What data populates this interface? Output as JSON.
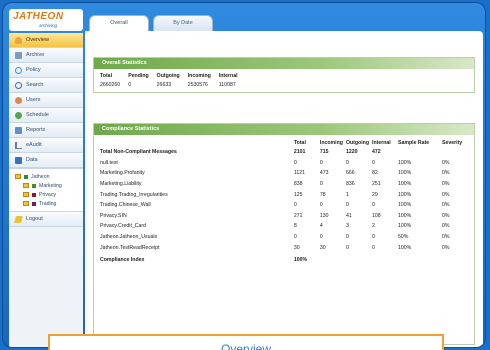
{
  "brand": {
    "name": "JATHEON",
    "tagline": "archiving"
  },
  "tabs": [
    {
      "label": "Overall",
      "active": true
    },
    {
      "label": "By Date",
      "active": false
    }
  ],
  "sidebar": {
    "items": [
      {
        "label": "Overview",
        "icon": "home-icon",
        "active": true
      },
      {
        "label": "Archive",
        "icon": "archive-icon"
      },
      {
        "label": "Policy",
        "icon": "policy-icon"
      },
      {
        "label": "Search",
        "icon": "search-icon"
      },
      {
        "label": "Users",
        "icon": "users-icon"
      },
      {
        "label": "Schedule",
        "icon": "schedule-icon"
      },
      {
        "label": "Reports",
        "icon": "reports-icon"
      },
      {
        "label": "eAudit",
        "icon": "audit-icon"
      },
      {
        "label": "Data",
        "icon": "data-icon"
      }
    ],
    "folders": [
      {
        "label": "Jatheon",
        "color": "#2e8b3a",
        "sub": false
      },
      {
        "label": "Marketing",
        "color": "#4a8a2a",
        "sub": true
      },
      {
        "label": "Privacy",
        "color": "#8a1a2a",
        "sub": true
      },
      {
        "label": "Trading",
        "color": "#6a1a7a",
        "sub": true
      }
    ],
    "logout": "Logout"
  },
  "overall": {
    "title": "Overall Statistics",
    "headers": [
      "Total",
      "Pending",
      "Outgoing",
      "Incoming",
      "Internal"
    ],
    "values": [
      "2660260",
      "0",
      "26633",
      "2530576",
      "110087"
    ]
  },
  "compliance": {
    "title": "Compliance Statistics",
    "headers": [
      "",
      "Total",
      "Incoming",
      "Outgoing",
      "Internal",
      "Sample Rate",
      "Severity"
    ],
    "summary": [
      "Total Non-Compliant Messages",
      "2101",
      "715",
      "1220",
      "472",
      "",
      ""
    ],
    "rows": [
      [
        "null.test",
        "0",
        "0",
        "0",
        "0",
        "100%",
        "0%"
      ],
      [
        "Marketing.Profanity",
        "1121",
        "473",
        "666",
        "82",
        "100%",
        "0%"
      ],
      [
        "Marketing.Liability",
        "838",
        "0",
        "836",
        "251",
        "100%",
        "0%"
      ],
      [
        "Trading.Trading_Irregularities",
        "125",
        "78",
        "1",
        "29",
        "100%",
        "0%"
      ],
      [
        "Trading.Chinese_Wall",
        "0",
        "0",
        "0",
        "0",
        "100%",
        "0%"
      ],
      [
        "Privacy.SIN",
        "271",
        "130",
        "41",
        "108",
        "100%",
        "0%"
      ],
      [
        "Privacy.Credit_Card",
        "8",
        "4",
        "3",
        "2",
        "100%",
        "0%"
      ],
      [
        "Jatheon.Jatheon_Usuals",
        "0",
        "0",
        "0",
        "0",
        "50%",
        "0%"
      ],
      [
        "Jatheon.TestReadReceipt",
        "30",
        "30",
        "0",
        "0",
        "100%",
        "0%"
      ]
    ],
    "index_label": "Compliance Index",
    "index_value": "100%"
  },
  "caption": "Overview"
}
